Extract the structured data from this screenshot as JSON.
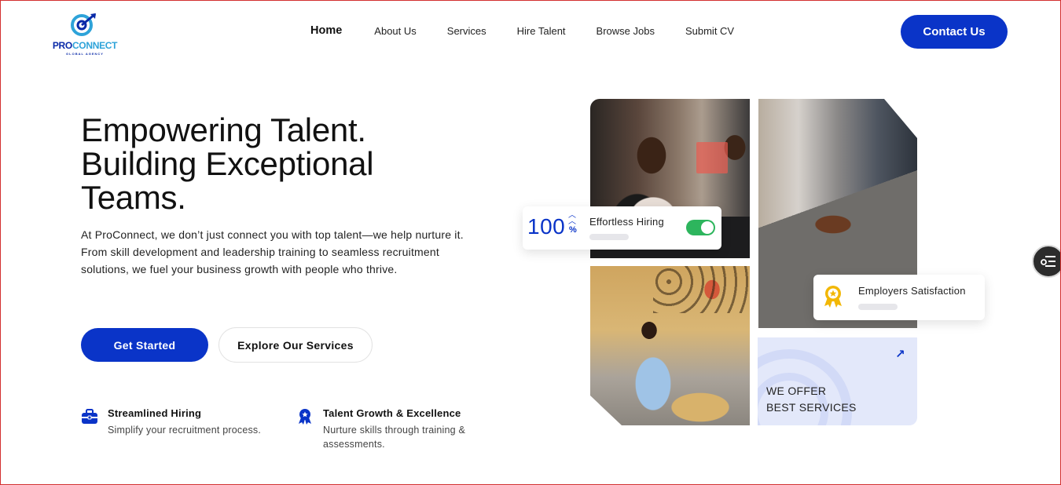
{
  "brand": {
    "name_part1": "PRO",
    "name_part2": "CONNECT",
    "tagline": "GLOBAL AGENCY",
    "primary_color": "#0a34c8"
  },
  "nav": {
    "items": [
      {
        "label": "Home",
        "active": true
      },
      {
        "label": "About Us"
      },
      {
        "label": "Services"
      },
      {
        "label": "Hire Talent"
      },
      {
        "label": "Browse Jobs"
      },
      {
        "label": "Submit CV"
      }
    ],
    "contact_label": "Contact Us"
  },
  "hero": {
    "title_line1": "Empowering Talent.",
    "title_line2": "Building Exceptional",
    "title_line3": "Teams.",
    "description": "At ProConnect, we don’t just connect you with top talent—we help nurture it. From skill development and leadership training to seamless recruitment solutions, we fuel your business growth with people who thrive.",
    "primary_button": "Get Started",
    "secondary_button": "Explore Our Services"
  },
  "features": [
    {
      "icon": "briefcase-icon",
      "title": "Streamlined Hiring",
      "description": "Simplify your recruitment process."
    },
    {
      "icon": "award-ribbon-icon",
      "title": "Talent Growth & Excellence",
      "description": "Nurture skills through training & assessments."
    }
  ],
  "stats_card": {
    "value": "100",
    "unit": "%",
    "label": "Effortless Hiring",
    "toggle_on": true,
    "toggle_color": "#2db55d"
  },
  "satisfaction_card": {
    "label": "Employers Satisfaction",
    "icon": "medal-icon",
    "icon_color": "#f2b705"
  },
  "offer_card": {
    "line1": "WE OFFER",
    "line2": "BEST SERVICES",
    "icon": "arrow-up-right-icon"
  },
  "side_widget": {
    "icon": "list-settings-icon"
  }
}
